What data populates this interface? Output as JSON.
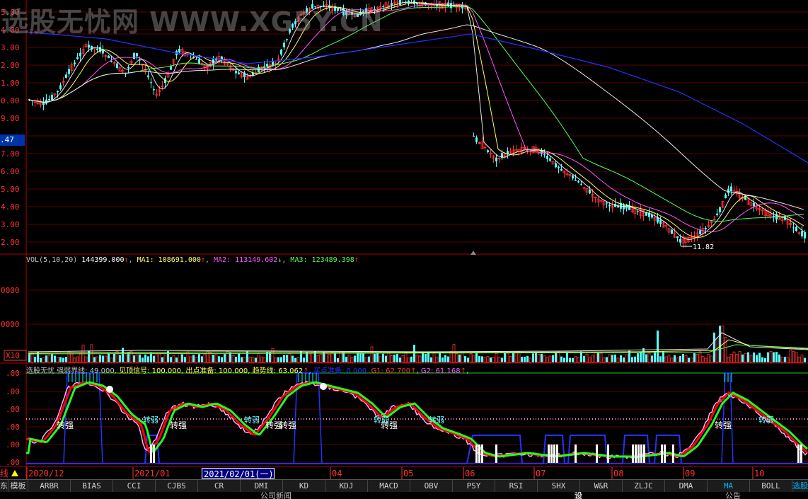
{
  "watermark": "选股无忧网  WWW.XG5Y.CN",
  "price_axis_labels": [
    "5.00",
    "4.00",
    "3.00",
    "2.00",
    "1.00",
    "0.00",
    "9.00",
    ".47",
    "7.00",
    "6.00",
    "5.00",
    "4.00",
    "3.00",
    "2.00"
  ],
  "current_price_tag": ".47",
  "low_marker": "11.82",
  "vol_header": {
    "name": "VOL(5,10,20)",
    "value": "144399.000",
    "value_arrow": "↑",
    "ma1_label": "MA1:",
    "ma1_value": "108691.000",
    "ma1_arrow": "↑",
    "ma2_label": "MA2:",
    "ma2_value": "113149.602",
    "ma2_arrow": "↓",
    "ma3_label": "MA3:",
    "ma3_value": "123489.398",
    "ma3_arrow": "↑"
  },
  "vol_axis_labels": [
    "0000",
    "0000"
  ],
  "vol_unit": "X10",
  "indicator_header": {
    "name": "选股无忧",
    "text1": "强弱界线: 49.000,",
    "text2": "见顶信号: 100.000,",
    "text3": "出点准备: 100.000,",
    "text4": "趋势线: 63.062",
    "arrow4": "↑",
    "text5": "买点准备: 0.000,",
    "text6": "G1: 62.700",
    "arrow6": "↑",
    "text7": "G2: 61.168",
    "arrow7": "↑",
    "text8": ","
  },
  "indicator_axis_labels": [
    ".00",
    ".00",
    ".00",
    ".00",
    ".00",
    ".00"
  ],
  "labels": {
    "zhuan_qiang": "转强",
    "zhuan_ruo": "转弱"
  },
  "date_axis": {
    "prefix": "线",
    "labels": [
      "2020/12",
      "2021/01",
      "04",
      "05",
      "06",
      "07",
      "08",
      "09",
      "10"
    ],
    "selected": "2021/02/01(一)"
  },
  "tabs": {
    "first": "东",
    "template": "模板",
    "items": [
      "ARBR",
      "BIAS",
      "CCI",
      "CJBS",
      "CR",
      "DMI",
      "KD",
      "KDJ",
      "MACD",
      "OBV",
      "PSY",
      "RSI",
      "SHX",
      "W&R",
      "ZLJC",
      "DMA",
      "MA",
      "BOLL"
    ],
    "active": "MA",
    "right": "选股"
  },
  "news": {
    "left": "公司新闻",
    "mid": "设",
    "right": "公告"
  },
  "colors": {
    "candle_up": "#ff3333",
    "candle_down": "#54ffff",
    "ma_white": "#e8e8e8",
    "ma_yellow": "#ffff66",
    "ma_magenta": "#ff55ff",
    "ma_green": "#55ff55",
    "ma_blue": "#2233ff",
    "grid": "#8b0000",
    "ind_red": "#ff0000",
    "ind_green": "#22ff22",
    "ind_pink": "#ffaaff",
    "ind_blue": "#2233ff"
  }
}
